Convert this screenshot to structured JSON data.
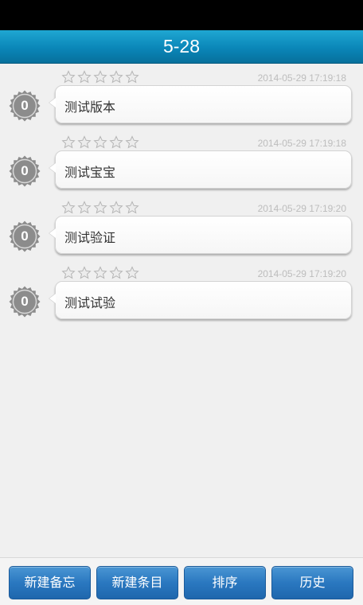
{
  "header": {
    "title": "5-28"
  },
  "memos": [
    {
      "count": "0",
      "title": "测试版本",
      "timestamp": "2014-05-29 17:19:18",
      "stars": 0
    },
    {
      "count": "0",
      "title": "测试宝宝",
      "timestamp": "2014-05-29 17:19:18",
      "stars": 0
    },
    {
      "count": "0",
      "title": "测试验证",
      "timestamp": "2014-05-29 17:19:20",
      "stars": 0
    },
    {
      "count": "0",
      "title": "测试试验",
      "timestamp": "2014-05-29 17:19:20",
      "stars": 0
    }
  ],
  "toolbar": {
    "new_memo": "新建备忘",
    "new_entry": "新建条目",
    "sort": "排序",
    "history": "历史"
  },
  "colors": {
    "header": "#0a86b8",
    "button": "#2a78c0",
    "badge": "#8c8c8c"
  }
}
